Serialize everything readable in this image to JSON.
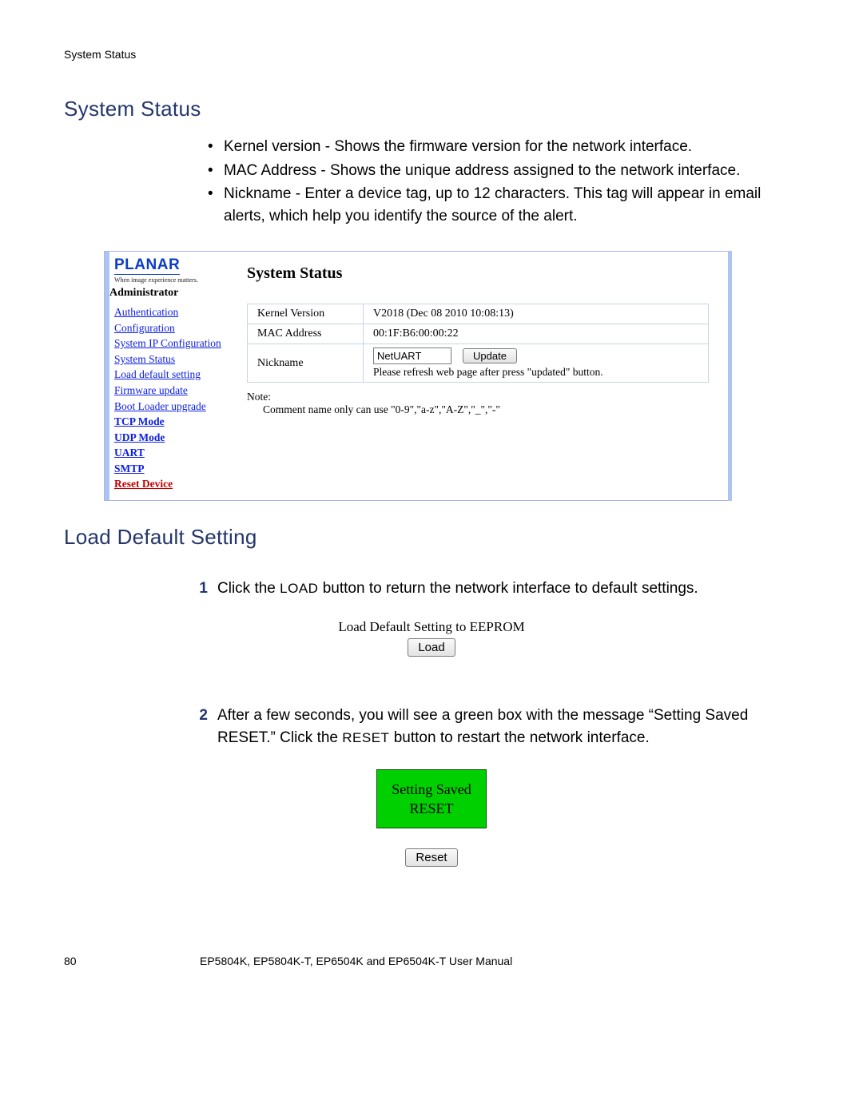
{
  "running_head": "System Status",
  "section1_title": "System Status",
  "bullets": [
    "Kernel version - Shows the firmware version for the network interface.",
    "MAC Address - Shows the unique address assigned to the network interface.",
    "Nickname - Enter a device tag, up to 12 characters. This tag will appear in email alerts, which help you identify the source of the alert."
  ],
  "shot1": {
    "brand": "PLANAR",
    "tagline": "When image experience matters.",
    "admin_label": "Administrator",
    "nav": [
      {
        "label": "Authentication Configuration",
        "style": "link"
      },
      {
        "label": "System IP Configuration",
        "style": "link"
      },
      {
        "label": "System Status",
        "style": "link"
      },
      {
        "label": "Load default setting",
        "style": "link"
      },
      {
        "label": "Firmware update",
        "style": "link"
      },
      {
        "label": "Boot Loader upgrade",
        "style": "link"
      },
      {
        "label": "TCP Mode",
        "style": "bold"
      },
      {
        "label": "UDP Mode",
        "style": "bold"
      },
      {
        "label": "UART",
        "style": "bold"
      },
      {
        "label": "SMTP",
        "style": "bold"
      },
      {
        "label": "Reset Device",
        "style": "red bold"
      }
    ],
    "panel_title": "System Status",
    "rows": {
      "kernel_label": "Kernel Version",
      "kernel_value": "V2018 (Dec 08 2010 10:08:13)",
      "mac_label": "MAC Address",
      "mac_value": "00:1F:B6:00:00:22",
      "nick_label": "Nickname",
      "nick_value": "NetUART",
      "update_btn": "Update",
      "refresh_msg": "Please refresh web page after press \"updated\" button."
    },
    "note_label": "Note:",
    "note_body": "Comment name only can use \"0-9\",\"a-z\",\"A-Z\",\"_\",\"-\""
  },
  "section2_title": "Load Default Setting",
  "steps": {
    "s1_pre": "Click the ",
    "s1_btnword": "LOAD",
    "s1_post": " button to return the network interface to default settings.",
    "s2_pre": "After a few seconds, you will see a green box with the message “Setting Saved RESET.” Click the ",
    "s2_btnword": "RESET",
    "s2_post": " button to restart the network interface."
  },
  "shot2": {
    "hdr": "Load Default Setting to EEPROM",
    "btn": "Load"
  },
  "shot3": {
    "line1": "Setting Saved",
    "line2": "RESET",
    "btn": "Reset"
  },
  "footer": {
    "page": "80",
    "title": "EP5804K, EP5804K-T, EP6504K and EP6504K-T User Manual"
  }
}
